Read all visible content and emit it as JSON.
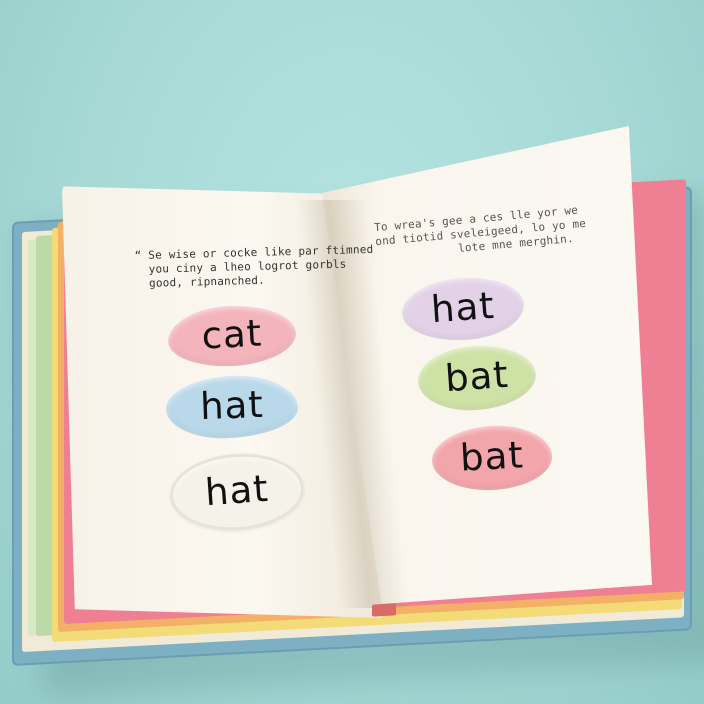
{
  "book": {
    "left_page": {
      "caption": "“ Se wise or cocke like par ftimned\n  you ciny a lheo logrot gorbls\n  good, ripnanched.",
      "words": [
        "cat",
        "hat",
        "hat"
      ]
    },
    "right_page": {
      "caption": "To wrea's gee a ces lle yor we\nond tiotid sveleigeed, lo yo me\n            lote mne merghin.",
      "words": [
        "hat",
        "bat",
        "bat"
      ]
    }
  },
  "colors": {
    "background": "#a6d9d6",
    "cover": "#7cb0c2",
    "blob_pink": "#f3b4bc",
    "blob_blue": "#b9d9ea",
    "blob_white": "#f5f2ea",
    "blob_lilac": "#e3d2e7",
    "blob_green": "#cfe2a6",
    "blob_red": "#f2a5aa"
  }
}
